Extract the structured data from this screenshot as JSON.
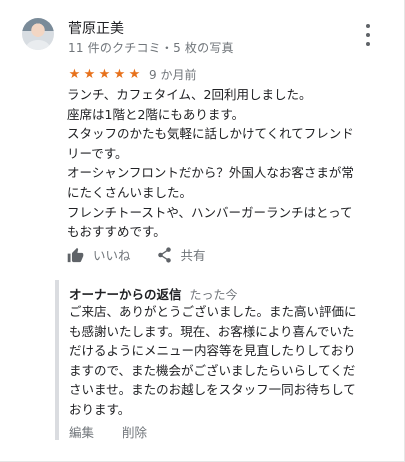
{
  "reviewer": {
    "name": "菅原正美",
    "meta": "11 件のクチコミ・5 枚の写真"
  },
  "review": {
    "stars": [
      "★",
      "★",
      "★",
      "★",
      "★"
    ],
    "rating": 5,
    "date": "9 か月前",
    "lines": [
      "ランチ、カフェタイム、2回利用しました。",
      "座席は1階と2階にもあります。",
      "スタッフのかたも気軽に話しかけてくれてフレンド",
      "リーです。",
      "オーシャンフロントだから？外国人なお客さまが常",
      "にたくさんいました。",
      "フレンチトーストや、ハンバーガーランチはとって",
      "もおすすめです。"
    ]
  },
  "actions": {
    "like_label": "いいね",
    "share_label": "共有"
  },
  "owner_reply": {
    "title": "オーナーからの返信",
    "time": "たった今",
    "lines": [
      "ご来店、ありがとうございました。また高い評価に",
      "も感謝いたします。現在、お客様により喜んでいた",
      "だけるようにメニュー内容等を見直したりしており",
      "ますので、また機会がございましたらいらしてくだ",
      "さいませ。またのお越しをスタッフ一同お待ちして",
      "おります。"
    ],
    "edit_label": "編集",
    "delete_label": "削除"
  },
  "colors": {
    "star": "#e7711b",
    "secondary_text": "#70757a",
    "primary_text": "#202124",
    "reply_border": "#dadce0"
  },
  "icons": {
    "menu": "more-vert-icon",
    "like": "thumb-up-icon",
    "share": "share-icon"
  }
}
